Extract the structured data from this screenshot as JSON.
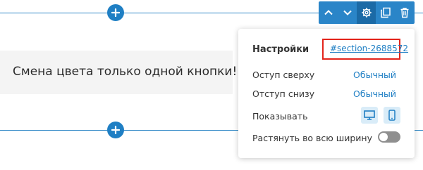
{
  "content": {
    "text": "Смена цвета только одной кнопки!"
  },
  "toolbar": {
    "icons": [
      "chevron-up-icon",
      "chevron-down-icon",
      "gear-icon",
      "copy-icon",
      "trash-icon"
    ]
  },
  "settings": {
    "title": "Настройки",
    "anchor": "#section-2688572",
    "rows": [
      {
        "label": "Оступ сверху",
        "value": "Обычный"
      },
      {
        "label": "Отступ снизу",
        "value": "Обычный"
      },
      {
        "label": "Показывать"
      },
      {
        "label": "Растянуть во всю ширину"
      }
    ],
    "stretch_toggle_on": false
  },
  "colors": {
    "accent": "#1f7fc4",
    "highlight": "#e3241b",
    "toggle_off": "#8f8f8f"
  }
}
